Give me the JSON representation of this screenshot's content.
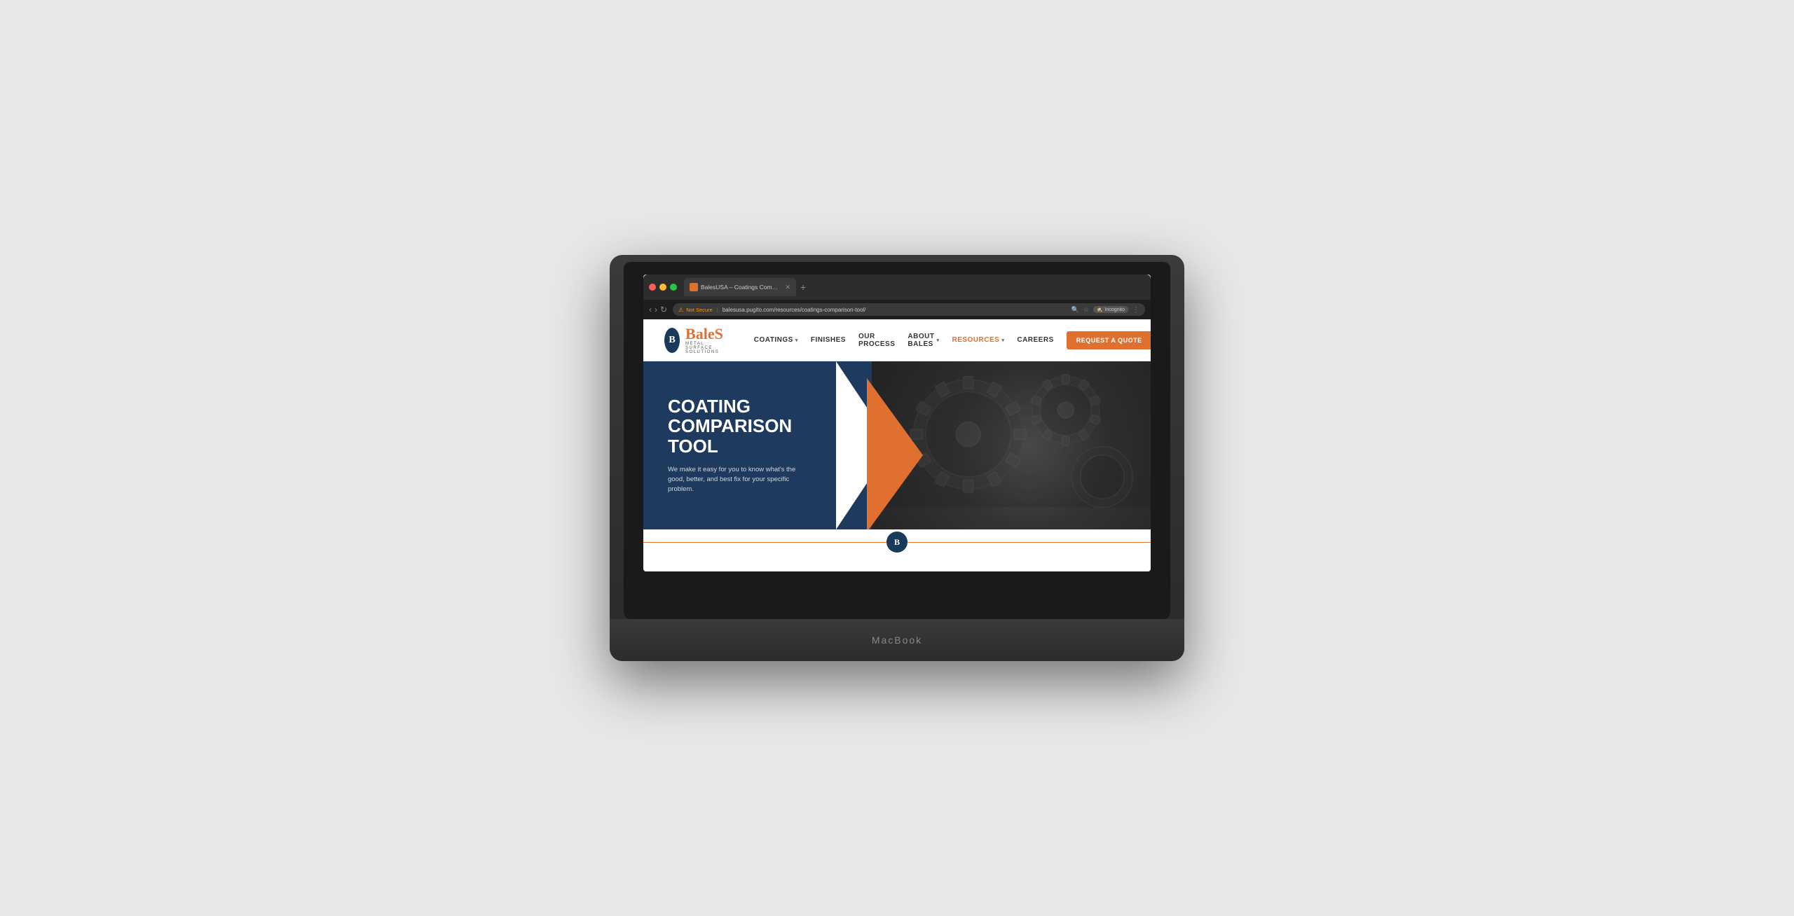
{
  "macbook": {
    "label": "MacBook"
  },
  "browser": {
    "tab_label": "BalesUSA – Coatings Compar...",
    "url": "balesusa.pugito.com/resources/coatings-comparison-tool/",
    "not_secure_label": "Not Secure",
    "incognito_label": "Incognito"
  },
  "site": {
    "logo": {
      "letter": "B",
      "brand": "BaleS",
      "sub": "Metal Surface Solutions"
    },
    "nav": {
      "coatings": "COATINGS",
      "finishes": "FINISHES",
      "our_process": "OUR PROCESS",
      "about_bales": "ABOUT BALES",
      "resources": "RESOURCES",
      "careers": "CAREERS",
      "request_btn": "REQUEST A QUOTE"
    },
    "hero": {
      "title_line1": "COATING",
      "title_line2": "COMPARISON",
      "title_line3": "TOOL",
      "description": "We make it easy for you to know what's the good, better, and best fix for your specific problem."
    },
    "divider": {
      "logo_letter": "B"
    }
  },
  "colors": {
    "orange": "#e07030",
    "navy": "#1e3a5f",
    "white": "#ffffff"
  }
}
